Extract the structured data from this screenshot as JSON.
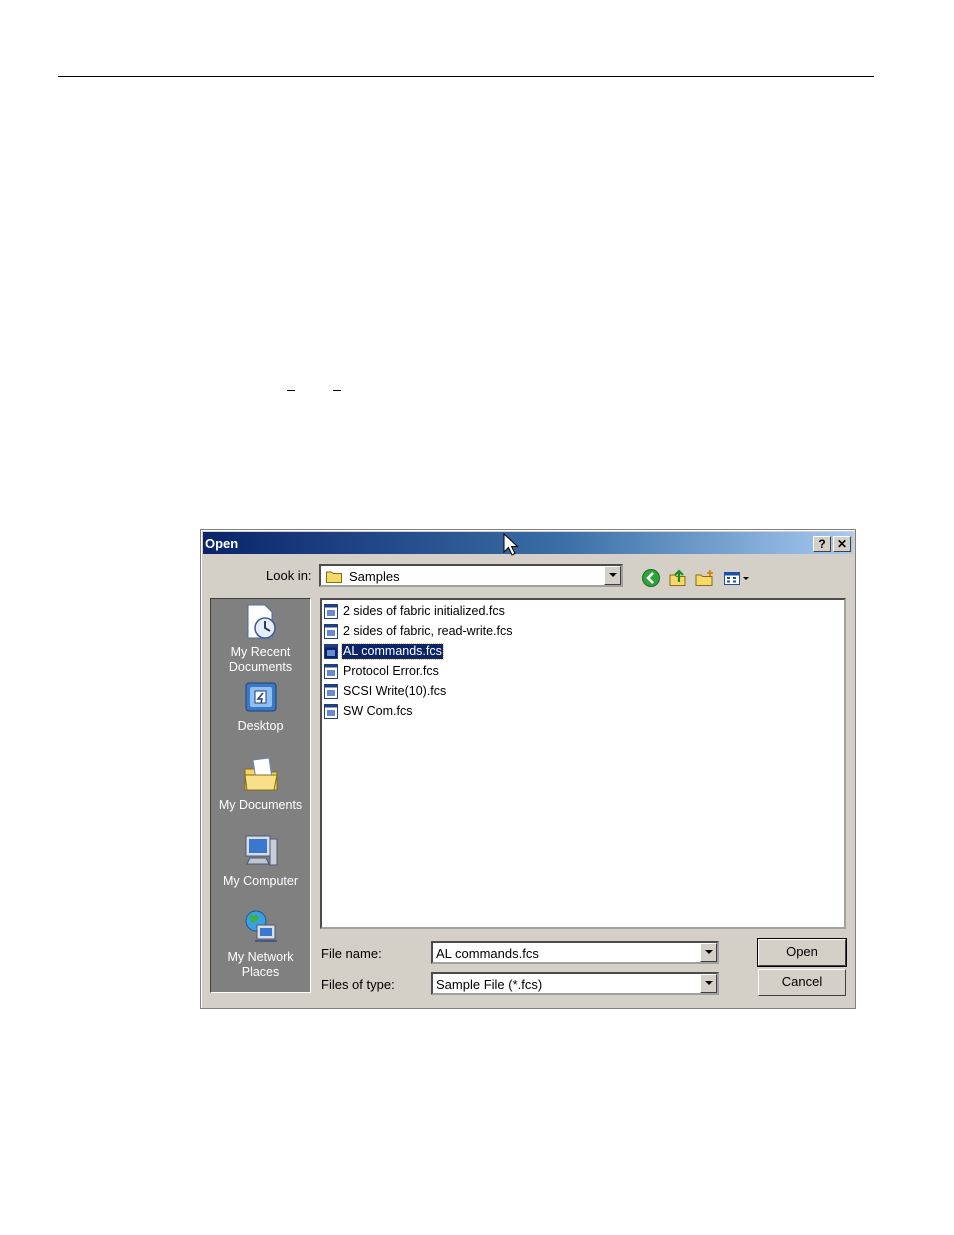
{
  "dialog": {
    "title": "Open",
    "help_label": "?",
    "close_label": "✕",
    "look_in_label": "Look in:",
    "look_in_value": "Samples",
    "toolbar_icons": [
      "back-icon",
      "up-folder-icon",
      "new-folder-icon",
      "view-menu-icon"
    ],
    "places": [
      {
        "label": "My Recent\nDocuments",
        "icon": "recent-documents-icon"
      },
      {
        "label": "Desktop",
        "icon": "desktop-icon"
      },
      {
        "label": "My Documents",
        "icon": "my-documents-icon"
      },
      {
        "label": "My Computer",
        "icon": "my-computer-icon"
      },
      {
        "label": "My Network\nPlaces",
        "icon": "network-places-icon"
      }
    ],
    "files": [
      {
        "name": "2 sides of fabric initialized.fcs",
        "selected": false
      },
      {
        "name": "2 sides of fabric, read-write.fcs",
        "selected": false
      },
      {
        "name": "AL commands.fcs",
        "selected": true
      },
      {
        "name": "Protocol Error.fcs",
        "selected": false
      },
      {
        "name": "SCSI Write(10).fcs",
        "selected": false
      },
      {
        "name": "SW Com.fcs",
        "selected": false
      }
    ],
    "file_name_label": "File name:",
    "file_name_value": "AL commands.fcs",
    "file_type_label": "Files of type:",
    "file_type_value": "Sample File (*.fcs)",
    "open_button": "Open",
    "cancel_button": "Cancel"
  },
  "colors": {
    "title_gradient_start": "#0a246a",
    "title_gradient_end": "#a6caf0",
    "dialog_face": "#d4d0c8",
    "places_bar": "#808080",
    "selection": "#0a246a"
  }
}
